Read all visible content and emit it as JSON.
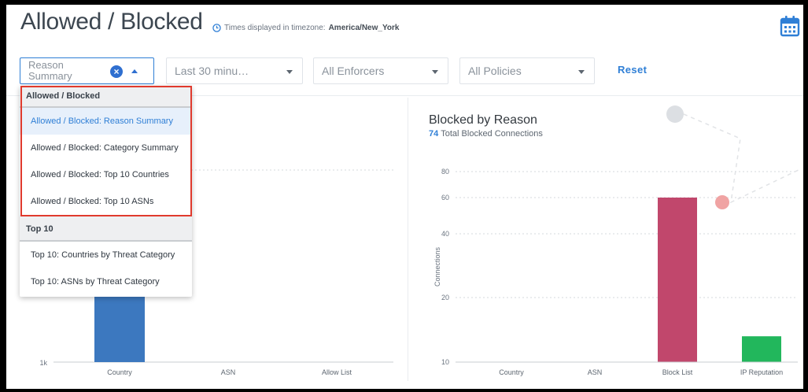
{
  "header": {
    "title": "Allowed / Blocked",
    "tz_prefix": "Times displayed in timezone:",
    "tz_value": "America/New_York"
  },
  "filters": {
    "reason_value": "Reason Summary",
    "time_value": "Last 30 minu…",
    "enforcers_value": "All Enforcers",
    "policies_value": "All Policies",
    "reset_label": "Reset"
  },
  "dropdown": {
    "groups": [
      {
        "label": "Allowed / Blocked",
        "options": [
          "Allowed / Blocked: Reason Summary",
          "Allowed / Blocked: Category Summary",
          "Allowed / Blocked: Top 10 Countries",
          "Allowed / Blocked: Top 10 ASNs"
        ]
      },
      {
        "label": "Top 10",
        "options": [
          "Top 10: Countries by Threat Category",
          "Top 10: ASNs by Threat Category"
        ]
      }
    ],
    "selected": "Allowed / Blocked: Reason Summary"
  },
  "colors": {
    "accent": "#2f7fd6",
    "highlight_box": "#e03a2d",
    "blue_bar": "#3c78bf",
    "red_bar": "#c1476c",
    "green_bar": "#22b75c"
  },
  "chart_data": [
    {
      "type": "bar",
      "title": "",
      "categories": [
        "Country",
        "ASN",
        "Allow List"
      ],
      "y_tick_labels": [
        "1k"
      ],
      "values": [
        null,
        0,
        0
      ],
      "note_visible": "first bar partly hidden behind dropdown"
    },
    {
      "type": "bar",
      "title": "Blocked by Reason",
      "subtitle_number": "74",
      "subtitle_text": "Total Blocked Connections",
      "ylabel": "Connections",
      "categories": [
        "Country",
        "ASN",
        "Block List",
        "IP Reputation"
      ],
      "values": [
        0,
        0,
        60,
        14
      ],
      "y_ticks": [
        10,
        20,
        40,
        60,
        80
      ],
      "bar_colors": [
        "#c1476c",
        "#c1476c",
        "#c1476c",
        "#22b75c"
      ]
    }
  ]
}
